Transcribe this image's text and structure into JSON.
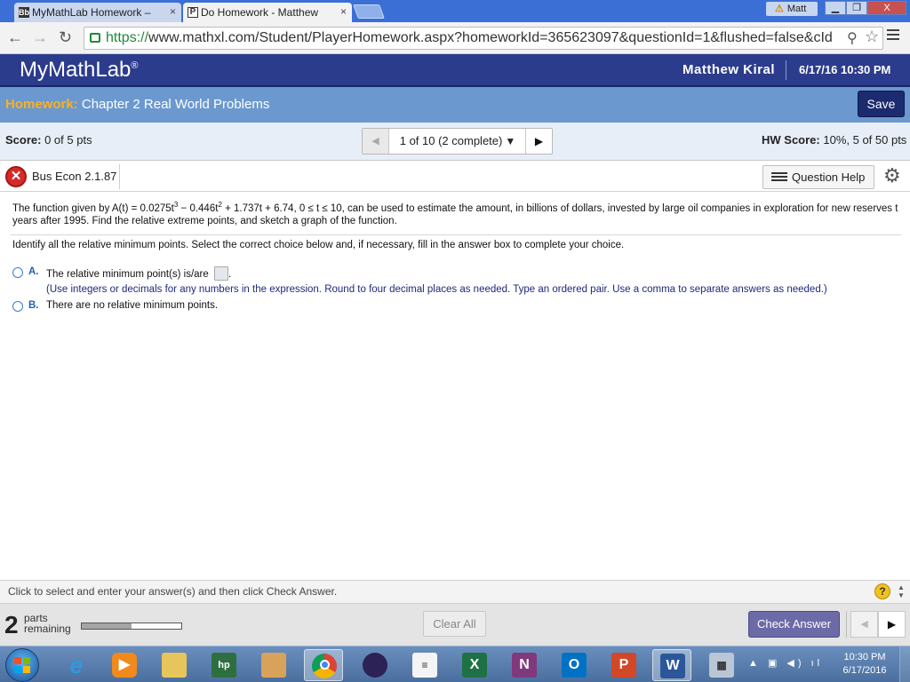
{
  "browser": {
    "tabs": [
      {
        "favicon": "Bb",
        "title": "MyMathLab Homework –"
      },
      {
        "favicon": "P",
        "title": "Do Homework - Matthew"
      }
    ],
    "tab_close": "×",
    "user_badge": "Matt",
    "window_buttons": {
      "minimize": "▁",
      "maximize": "❐",
      "close": "X"
    },
    "url_scheme": "https://",
    "url_rest": "www.mathxl.com/Student/PlayerHomework.aspx?homeworkId=365623097&questionId=1&flushed=false&cId"
  },
  "header": {
    "logo": "MyMathLab",
    "logo_mark": "®",
    "user": "Matthew Kiral",
    "datetime": "6/17/16 10:30 PM"
  },
  "homework": {
    "label": "Homework:",
    "title": "Chapter 2 Real World Problems",
    "save": "Save"
  },
  "scorebar": {
    "score_label": "Score:",
    "score_value": "0 of 5 pts",
    "question_select": "1 of 10 (2 complete)",
    "hw_score_label": "HW Score:",
    "hw_score_value": "10%, 5 of 50 pts"
  },
  "question": {
    "id": "Bus Econ 2.1.87",
    "help": "Question Help",
    "text_1": "The function given by A(t) = 0.0275t",
    "exp_1": "3",
    "text_2": " − 0.446t",
    "exp_2": "2",
    "text_3": " + 1.737t + 6.74, 0 ≤ t ≤ 10, can be used to estimate the amount, in billions of dollars, invested by large oil companies in exploration for new reserves t years after 1995. Find the relative extreme points, and sketch a graph of the function.",
    "instruction": "Identify all the relative minimum points. Select the correct choice below and, if necessary, fill in the answer box to complete your choice.",
    "option_a_letter": "A.",
    "option_a_text": "The relative minimum point(s) is/are",
    "option_a_period": ".",
    "option_a_hint": "(Use integers or decimals for any numbers in the expression. Round to four decimal places as needed. Type an ordered pair. Use a comma to separate answers as needed.)",
    "option_b_letter": "B.",
    "option_b_text": "There are no relative minimum points."
  },
  "footer": {
    "status": "Click to select and enter your answer(s) and then click Check Answer.",
    "help_icon": "?",
    "parts_count": "2",
    "parts_label_1": "parts",
    "parts_label_2": "remaining",
    "progress_fraction": 0.5,
    "clear_all": "Clear All",
    "check_answer": "Check Answer"
  },
  "taskbar": {
    "apps": [
      "internet-explorer",
      "media-player",
      "file-explorer",
      "hp-printer",
      "paint",
      "chrome",
      "eclipse",
      "news",
      "excel",
      "onenote",
      "outlook",
      "powerpoint",
      "word",
      "calculator"
    ],
    "clock_time": "10:30 PM",
    "clock_date": "6/17/2016"
  },
  "colors": {
    "header_bg": "#2c3c8c",
    "homework_bar": "#6b98cf",
    "homework_label": "#ffb01e",
    "check_answer_bg": "#6d6aa8",
    "incorrect": "#d42a2a"
  }
}
